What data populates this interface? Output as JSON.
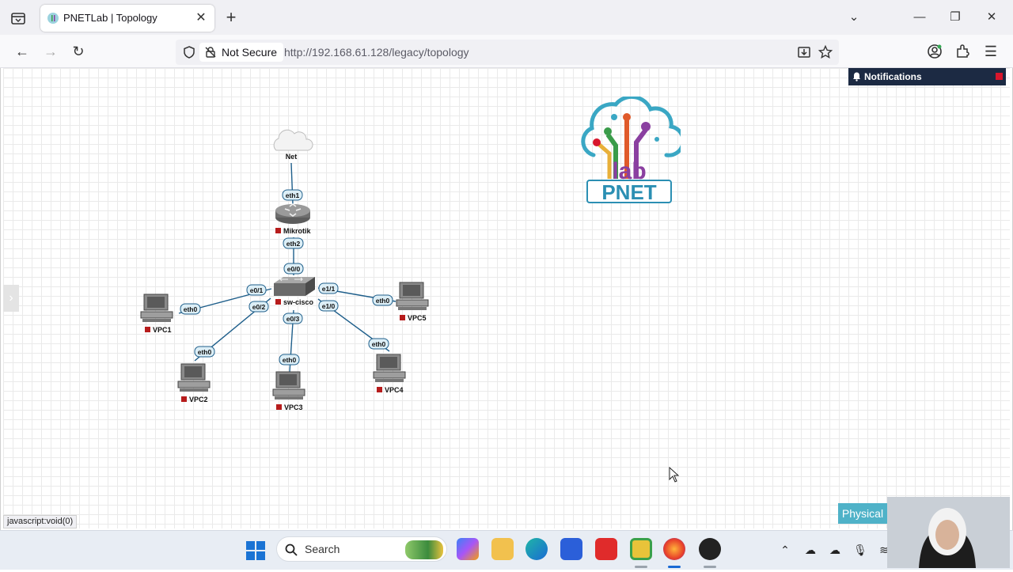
{
  "browser": {
    "tab_title": "PNETLab | Topology",
    "security_label": "Not Secure",
    "url": "http://192.168.61.128/legacy/topology"
  },
  "notifications": {
    "title": "Notifications"
  },
  "topology": {
    "nodes": {
      "net": "Net",
      "mikrotik": "Mikrotik",
      "switch": "sw-cisco",
      "vpc1": "VPC1",
      "vpc2": "VPC2",
      "vpc3": "VPC3",
      "vpc4": "VPC4",
      "vpc5": "VPC5"
    },
    "ports": {
      "mikrotik_eth1": "eth1",
      "mikrotik_eth2": "eth2",
      "sw_e00": "e0/0",
      "sw_e01": "e0/1",
      "sw_e02": "e0/2",
      "sw_e03": "e0/3",
      "sw_e10": "e1/0",
      "sw_e11": "e1/1",
      "vpc1_eth0": "eth0",
      "vpc2_eth0": "eth0",
      "vpc3_eth0": "eth0",
      "vpc4_eth0": "eth0",
      "vpc5_eth0": "eth0"
    },
    "node_status_color": "#b71c1c",
    "link_color": "#1f5f8b"
  },
  "logo": {
    "text": "PNET",
    "sub": "lab"
  },
  "status_bar": {
    "link": "javascript:void(0)"
  },
  "view_button": "Physical",
  "taskbar": {
    "search_label": "Search"
  }
}
